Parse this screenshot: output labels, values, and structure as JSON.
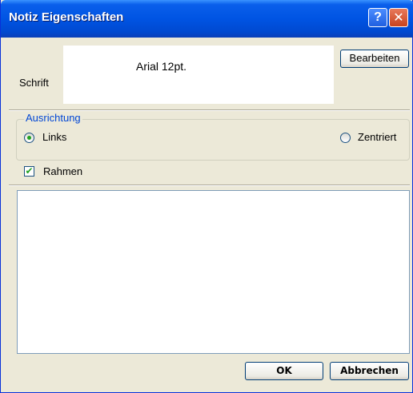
{
  "window": {
    "title": "Notiz Eigenschaften",
    "help_glyph": "?",
    "close_glyph": "✕"
  },
  "font_section": {
    "label": "Schrift",
    "preview_text": "Arial 12pt.",
    "edit_button": "Bearbeiten"
  },
  "alignment": {
    "legend": "Ausrichtung",
    "options": [
      {
        "label": "Links",
        "selected": true
      },
      {
        "label": "Zentriert",
        "selected": false
      }
    ]
  },
  "frame": {
    "label": "Rahmen",
    "checked": true
  },
  "note": {
    "value": ""
  },
  "footer": {
    "ok_label": "OK",
    "cancel_label": "Abbrechen"
  },
  "colors": {
    "titlebar": "#0054E3",
    "dialog_bg": "#ECE9D8",
    "legend_text": "#0046D5",
    "check_accent": "#21A121"
  }
}
